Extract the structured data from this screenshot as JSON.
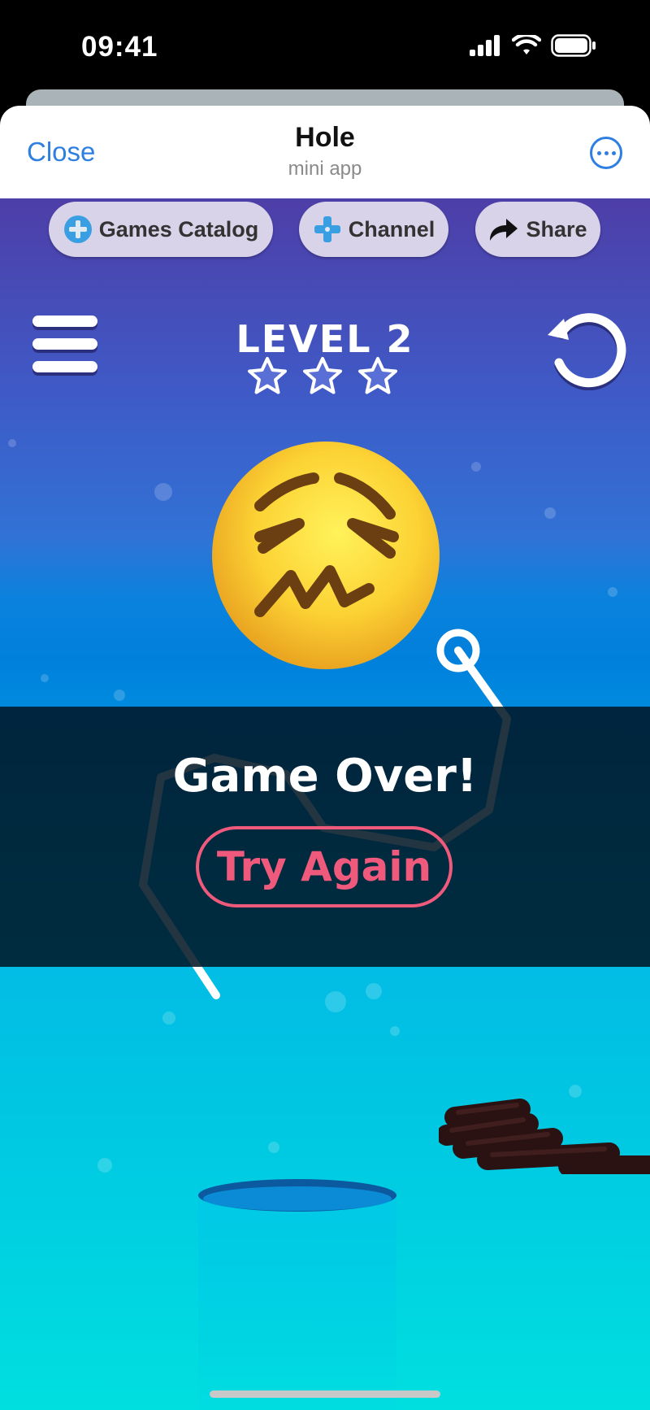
{
  "status_bar": {
    "time": "09:41"
  },
  "header": {
    "close_label": "Close",
    "title": "Hole",
    "subtitle": "mini app"
  },
  "toolbar": {
    "buttons": [
      {
        "label": "Games Catalog",
        "icon": "gamepad-icon"
      },
      {
        "label": "Channel",
        "icon": "plus-gamepad-icon"
      },
      {
        "label": "Share",
        "icon": "share-arrow-icon"
      }
    ]
  },
  "game": {
    "level_label": "LEVEL 2",
    "stars_earned": 0,
    "stars_total": 3,
    "game_over_text": "Game Over!",
    "try_again_label": "Try Again",
    "colors": {
      "accent": "#ef5a7c",
      "link": "#2f7fe0",
      "top_gradient": "#4e3ea8",
      "bottom_gradient": "#00dfe0"
    }
  }
}
